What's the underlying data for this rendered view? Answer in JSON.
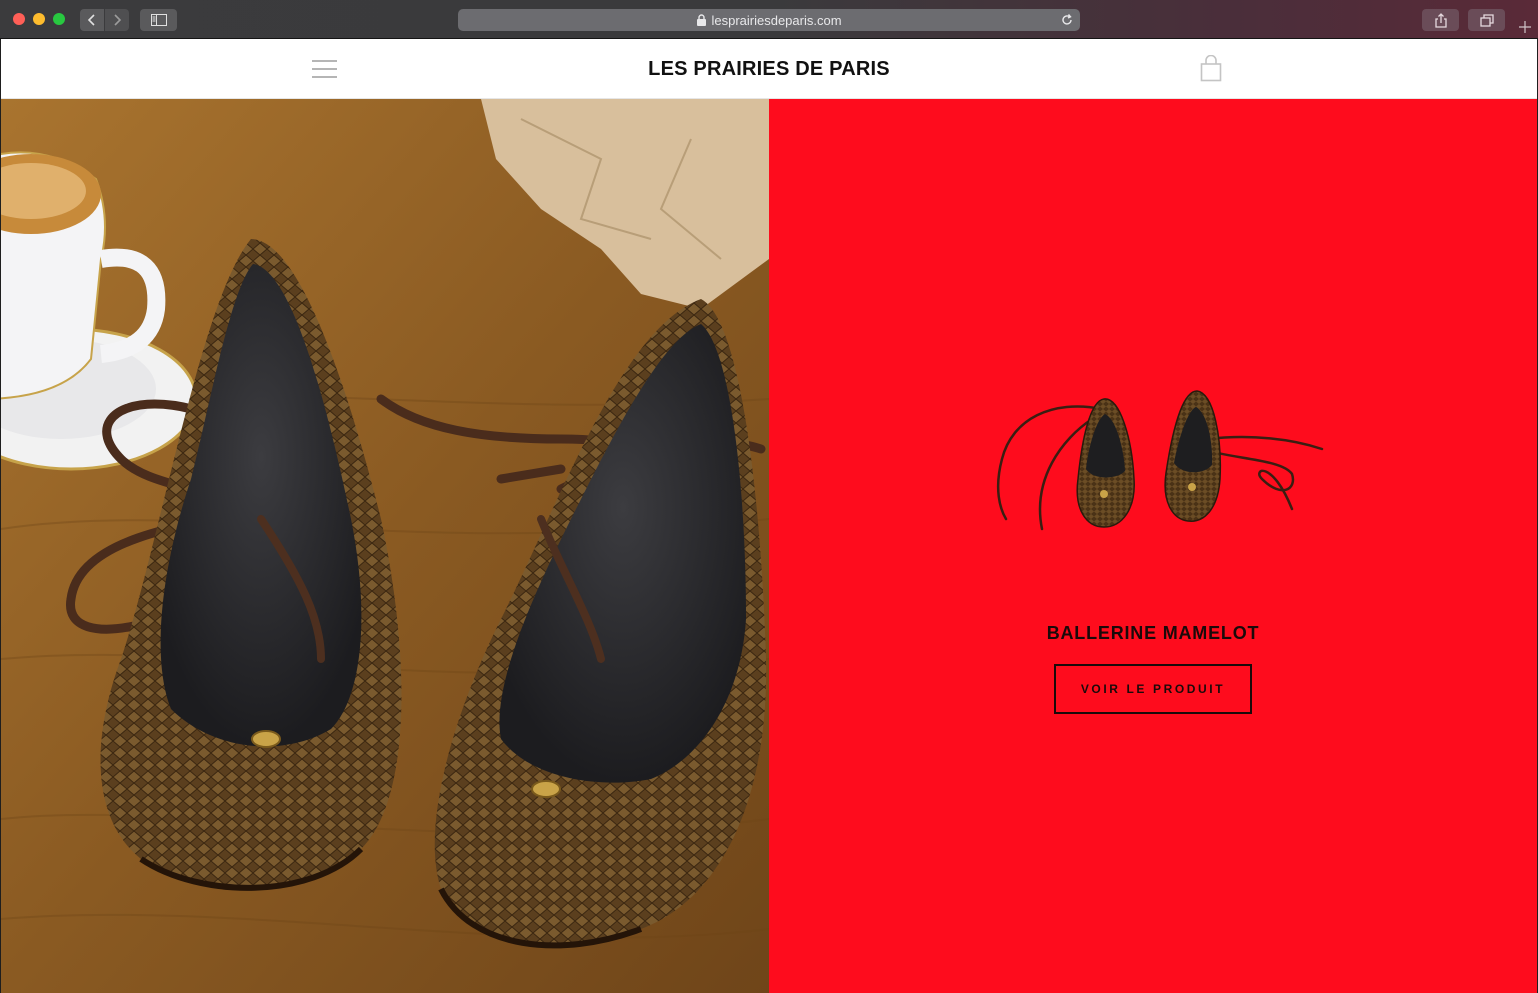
{
  "browser": {
    "url": "lesprairiesdeparis.com"
  },
  "header": {
    "logo": "LES PRAIRIES DE PARIS",
    "menu_icon": "hamburger-menu-icon",
    "cart_icon": "shopping-bag-icon"
  },
  "hero": {
    "image_alt": "lifestyle-photo-snakeskin-ballerinas"
  },
  "product": {
    "name": "BALLERINE MAMELOT",
    "cta_label": "VOIR LE PRODUIT",
    "panel_color": "#fe0c1d"
  }
}
